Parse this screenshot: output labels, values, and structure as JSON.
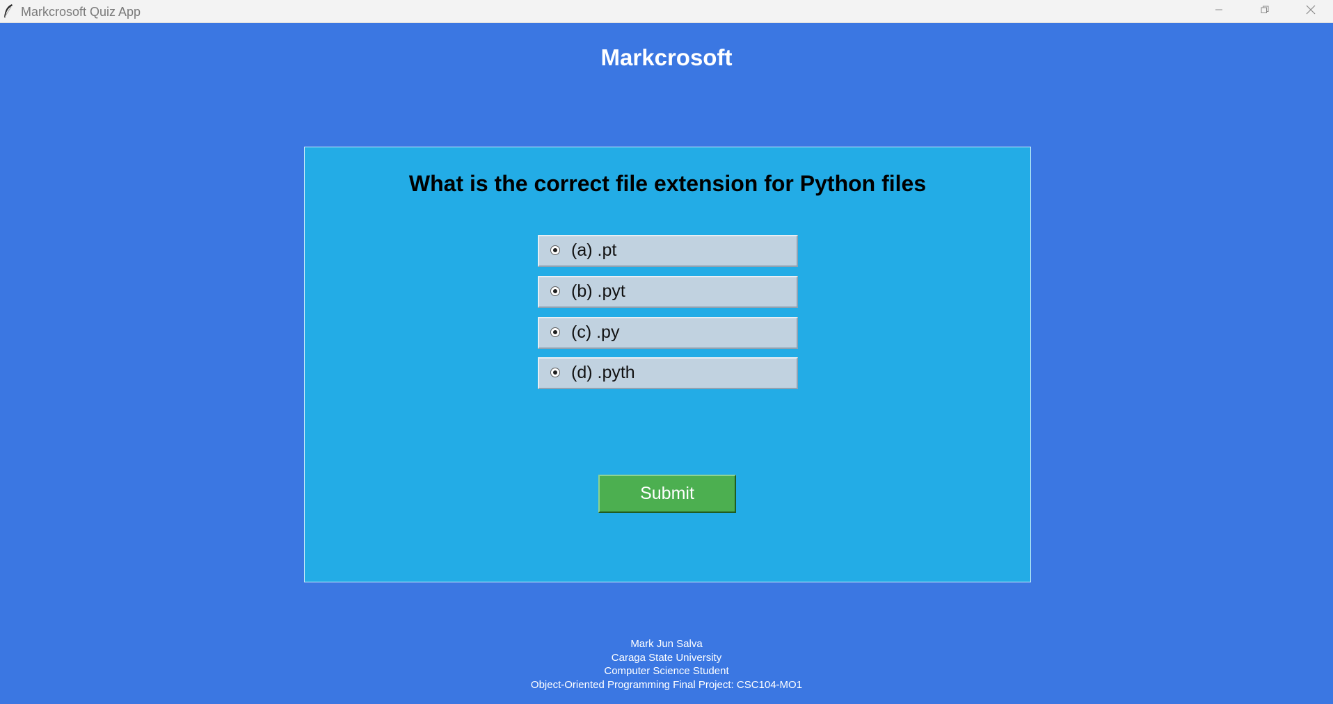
{
  "window": {
    "title": "Markcrosoft Quiz App",
    "icons": {
      "app": "feather-icon",
      "minimize": "minimize-icon",
      "maximize": "restore-icon",
      "close": "close-icon"
    }
  },
  "header": {
    "brand": "Markcrosoft"
  },
  "quiz": {
    "question": "What is the correct file extension for Python files",
    "options": [
      {
        "label": "(a) .pt"
      },
      {
        "label": "(b) .pyt"
      },
      {
        "label": "(c) .py"
      },
      {
        "label": "(d) .pyth"
      }
    ],
    "submit_label": "Submit"
  },
  "footer": {
    "lines": [
      "Mark Jun Salva",
      "Caraga State University",
      "Computer Science Student",
      "Object-Oriented Programming Final Project: CSC104-MO1"
    ]
  },
  "colors": {
    "background": "#3B77E2",
    "panel": "#23ACE6",
    "option": "#C1D2E0",
    "submit": "#4CAF50"
  }
}
